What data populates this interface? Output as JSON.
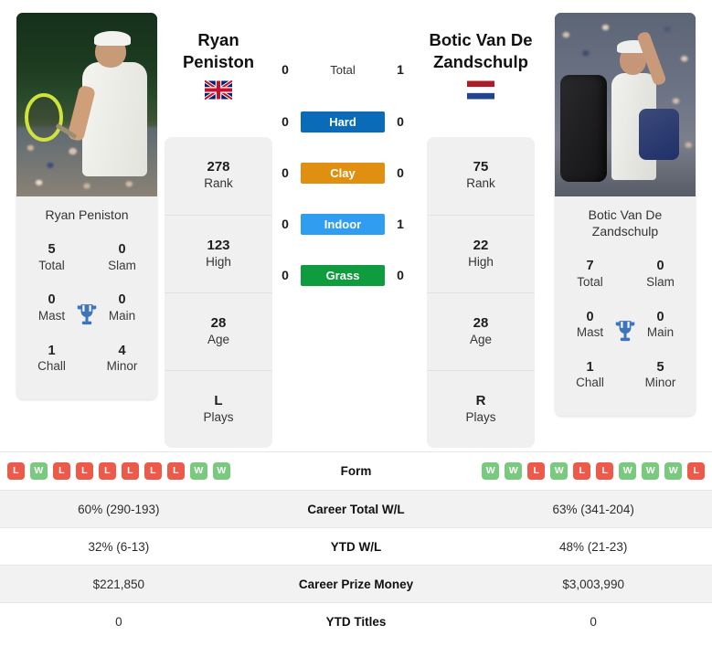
{
  "players": {
    "left": {
      "name": "Ryan Peniston",
      "name_line1": "Ryan",
      "name_line2": "Peniston",
      "flag": "gb-flag-icon",
      "flag_alt": "United Kingdom",
      "photo_alt": "Ryan Peniston on grass court holding racket",
      "titles": [
        {
          "value": "5",
          "label": "Total"
        },
        {
          "value": "0",
          "label": "Slam"
        },
        {
          "value": "0",
          "label": "Mast"
        },
        {
          "value": "0",
          "label": "Main"
        },
        {
          "value": "1",
          "label": "Chall"
        },
        {
          "value": "4",
          "label": "Minor"
        }
      ],
      "stats": [
        {
          "value": "278",
          "label": "Rank"
        },
        {
          "value": "123",
          "label": "High"
        },
        {
          "value": "28",
          "label": "Age"
        },
        {
          "value": "L",
          "label": "Plays"
        }
      ],
      "form": [
        "L",
        "W",
        "L",
        "L",
        "L",
        "L",
        "L",
        "L",
        "W",
        "W"
      ]
    },
    "right": {
      "name": "Botic Van De Zandschulp",
      "name_line1": "Botic Van De",
      "name_line2": "Zandschulp",
      "flag": "nl-flag-icon",
      "flag_alt": "Netherlands",
      "photo_alt": "Botic Van De Zandschulp waving with racket bag",
      "titles": [
        {
          "value": "7",
          "label": "Total"
        },
        {
          "value": "0",
          "label": "Slam"
        },
        {
          "value": "0",
          "label": "Mast"
        },
        {
          "value": "0",
          "label": "Main"
        },
        {
          "value": "1",
          "label": "Chall"
        },
        {
          "value": "5",
          "label": "Minor"
        }
      ],
      "stats": [
        {
          "value": "75",
          "label": "Rank"
        },
        {
          "value": "22",
          "label": "High"
        },
        {
          "value": "28",
          "label": "Age"
        },
        {
          "value": "R",
          "label": "Plays"
        }
      ],
      "form": [
        "W",
        "W",
        "L",
        "W",
        "L",
        "L",
        "W",
        "W",
        "W",
        "L"
      ]
    }
  },
  "h2h": [
    {
      "label": "Total",
      "left": "0",
      "right": "1",
      "color": "none",
      "is_header": true
    },
    {
      "label": "Hard",
      "left": "0",
      "right": "0",
      "color": "#0a6cb8",
      "is_header": false
    },
    {
      "label": "Clay",
      "left": "0",
      "right": "0",
      "color": "#e09010",
      "is_header": false
    },
    {
      "label": "Indoor",
      "left": "0",
      "right": "1",
      "color": "#2f9ef0",
      "is_header": false
    },
    {
      "label": "Grass",
      "left": "0",
      "right": "0",
      "color": "#0e9c3e",
      "is_header": false
    }
  ],
  "comparison": [
    {
      "label": "Form",
      "left": "",
      "right": "",
      "type": "form"
    },
    {
      "label": "Career Total W/L",
      "left": "60% (290-193)",
      "right": "63% (341-204)",
      "type": "text"
    },
    {
      "label": "YTD W/L",
      "left": "32% (6-13)",
      "right": "48% (21-23)",
      "type": "text"
    },
    {
      "label": "Career Prize Money",
      "left": "$221,850",
      "right": "$3,003,990",
      "type": "text"
    },
    {
      "label": "YTD Titles",
      "left": "0",
      "right": "0",
      "type": "text"
    }
  ],
  "colors": {
    "trophy": "#3e74bb",
    "win": "#79c97f",
    "loss": "#ec5a49",
    "card_bg": "#f0f0f0",
    "row_alt": "#f2f2f2"
  },
  "icons": {
    "trophy": "trophy-icon"
  }
}
